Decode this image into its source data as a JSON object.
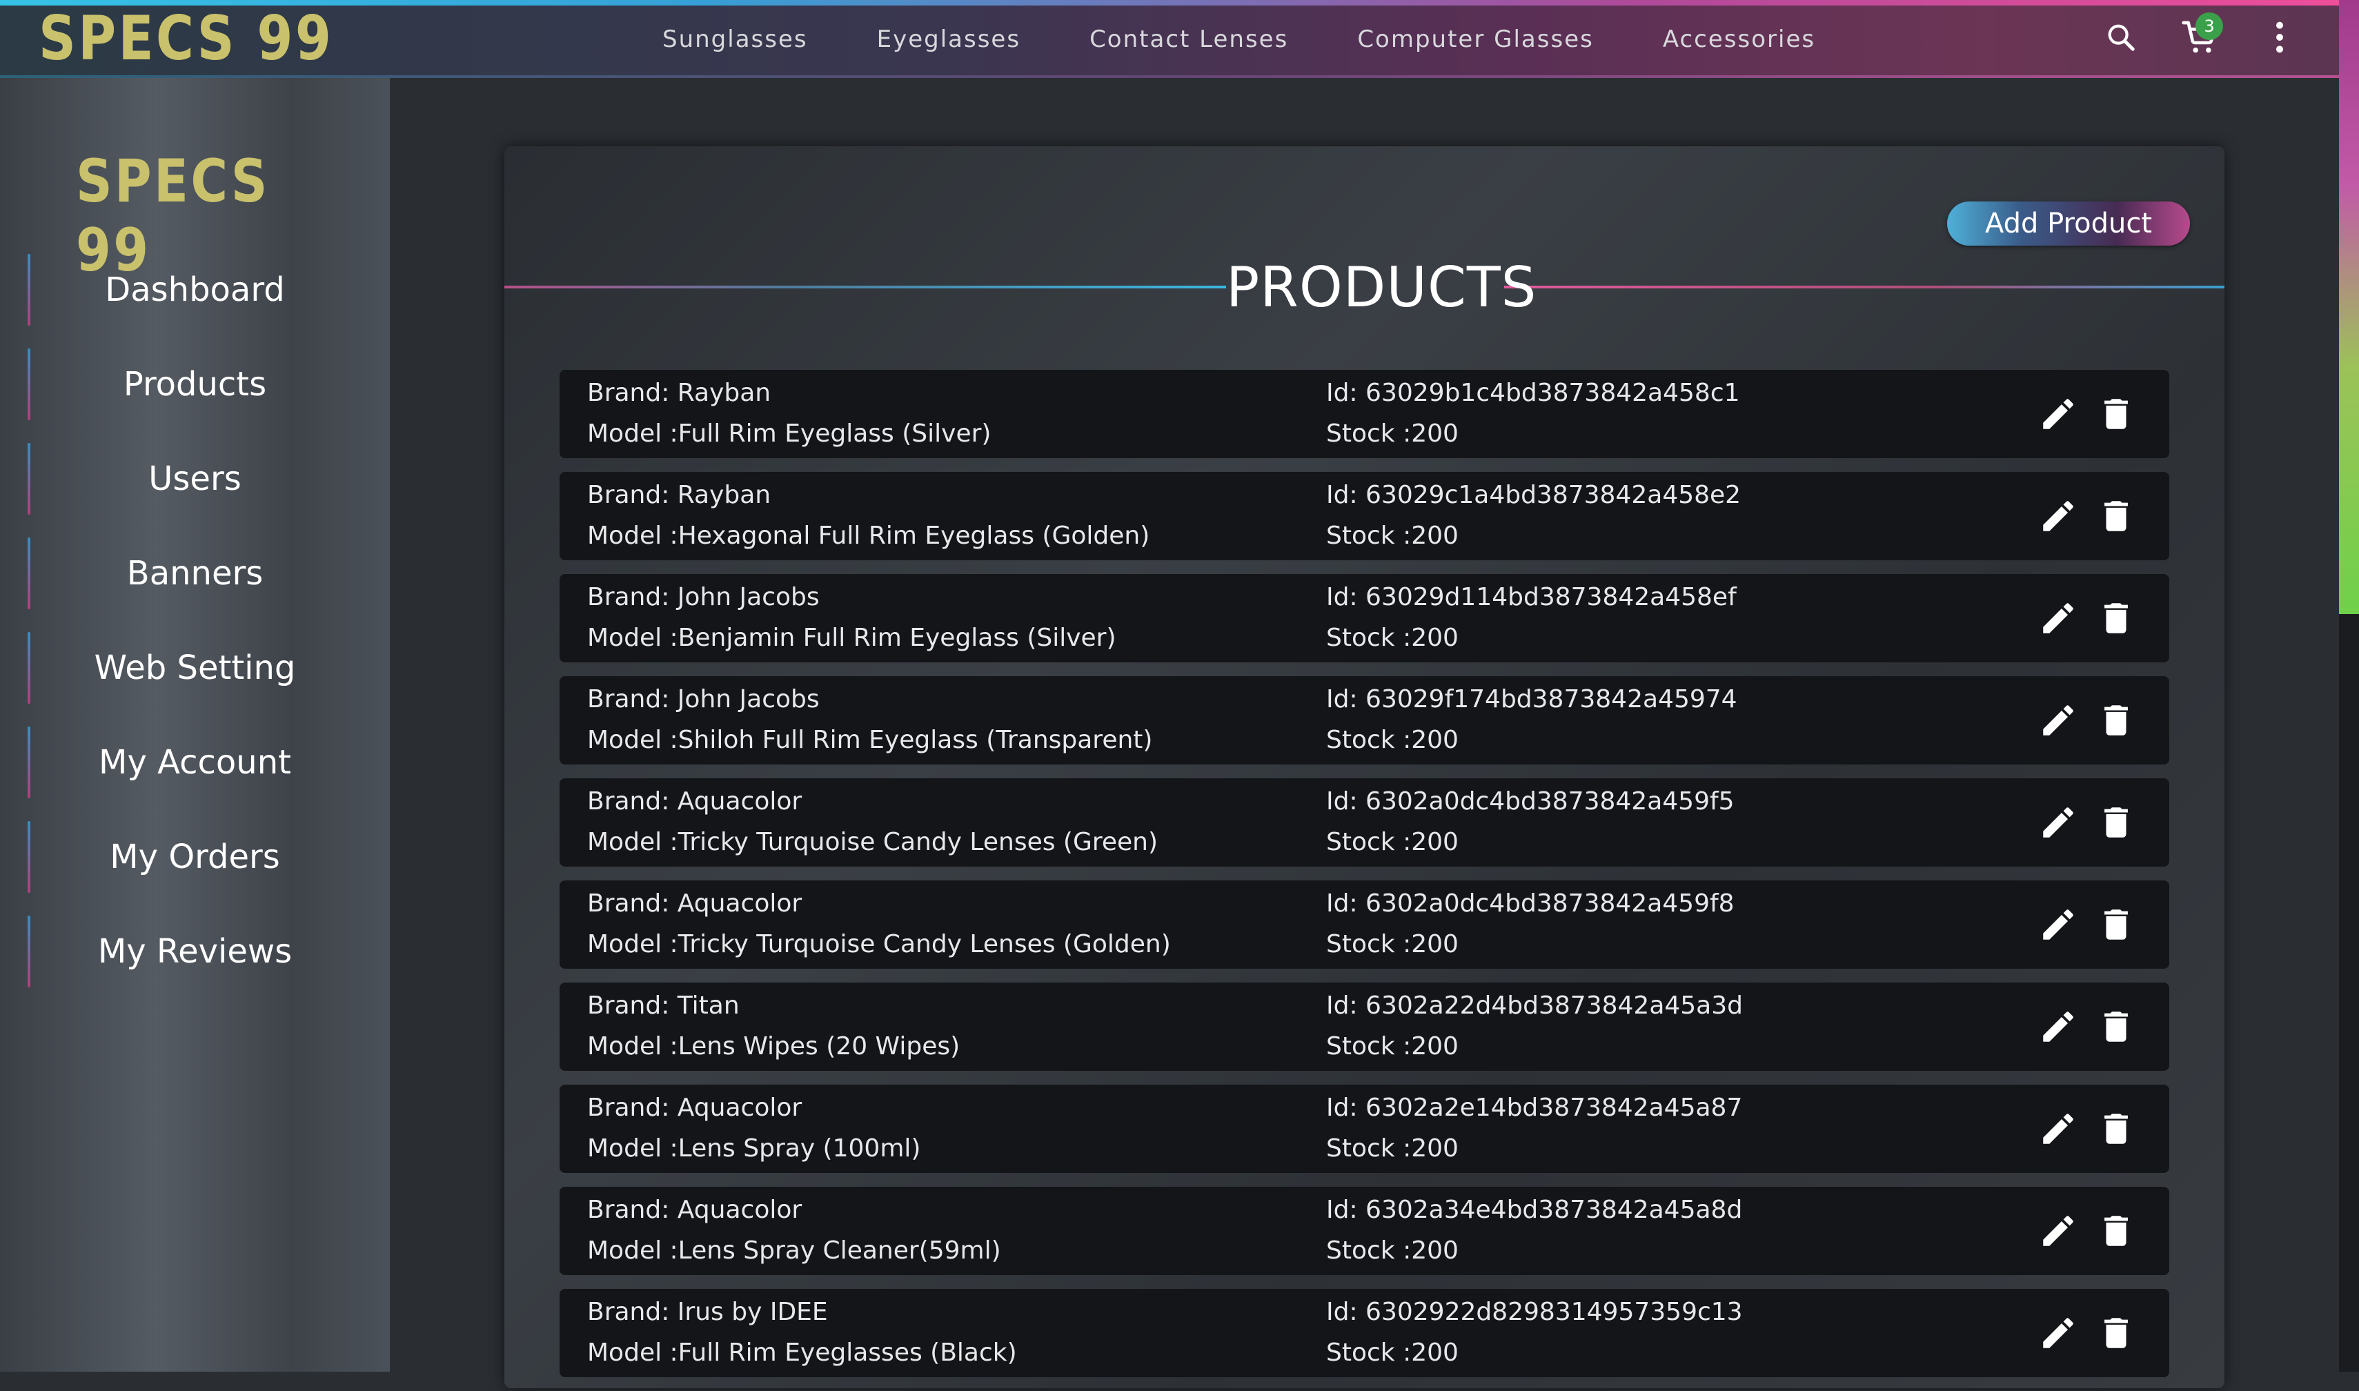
{
  "header": {
    "logo": "SPECS 99",
    "nav": [
      "Sunglasses",
      "Eyeglasses",
      "Contact Lenses",
      "Computer Glasses",
      "Accessories"
    ],
    "cart_count": "3",
    "icons": [
      "search-icon",
      "cart-icon",
      "more-vertical-icon"
    ]
  },
  "sidebar": {
    "logo": "SPECS 99",
    "items": [
      "Dashboard",
      "Products",
      "Users",
      "Banners",
      "Web Setting",
      "My Account",
      "My Orders",
      "My Reviews"
    ]
  },
  "main": {
    "title": "PRODUCTS",
    "add_label": "Add Product",
    "products": [
      {
        "brand": "Brand: Rayban",
        "model": "Model :Full Rim Eyeglass (Silver)",
        "id": "Id: 63029b1c4bd3873842a458c1",
        "stock": "Stock :200"
      },
      {
        "brand": "Brand: Rayban",
        "model": "Model :Hexagonal Full Rim Eyeglass (Golden)",
        "id": "Id: 63029c1a4bd3873842a458e2",
        "stock": "Stock :200"
      },
      {
        "brand": "Brand: John Jacobs",
        "model": "Model :Benjamin Full Rim Eyeglass (Silver)",
        "id": "Id: 63029d114bd3873842a458ef",
        "stock": "Stock :200"
      },
      {
        "brand": "Brand: John Jacobs",
        "model": "Model :Shiloh Full Rim Eyeglass (Transparent)",
        "id": "Id: 63029f174bd3873842a45974",
        "stock": "Stock :200"
      },
      {
        "brand": "Brand: Aquacolor",
        "model": "Model :Tricky Turquoise Candy Lenses (Green)",
        "id": "Id: 6302a0dc4bd3873842a459f5",
        "stock": "Stock :200"
      },
      {
        "brand": "Brand: Aquacolor",
        "model": "Model :Tricky Turquoise Candy Lenses (Golden)",
        "id": "Id: 6302a0dc4bd3873842a459f8",
        "stock": "Stock :200"
      },
      {
        "brand": "Brand: Titan",
        "model": "Model :Lens Wipes (20 Wipes)",
        "id": "Id: 6302a22d4bd3873842a45a3d",
        "stock": "Stock :200"
      },
      {
        "brand": "Brand: Aquacolor",
        "model": "Model :Lens Spray (100ml)",
        "id": "Id: 6302a2e14bd3873842a45a87",
        "stock": "Stock :200"
      },
      {
        "brand": "Brand: Aquacolor",
        "model": "Model :Lens Spray Cleaner(59ml)",
        "id": "Id: 6302a34e4bd3873842a45a8d",
        "stock": "Stock :200"
      },
      {
        "brand": "Brand: Irus by IDEE",
        "model": "Model :Full Rim Eyeglasses (Black)",
        "id": "Id: 6302922d8298314957359c13",
        "stock": "Stock :200"
      }
    ]
  },
  "colors": {
    "logo": "#c9c16c",
    "row_bg": "#131518",
    "badge": "#3aa14a"
  }
}
